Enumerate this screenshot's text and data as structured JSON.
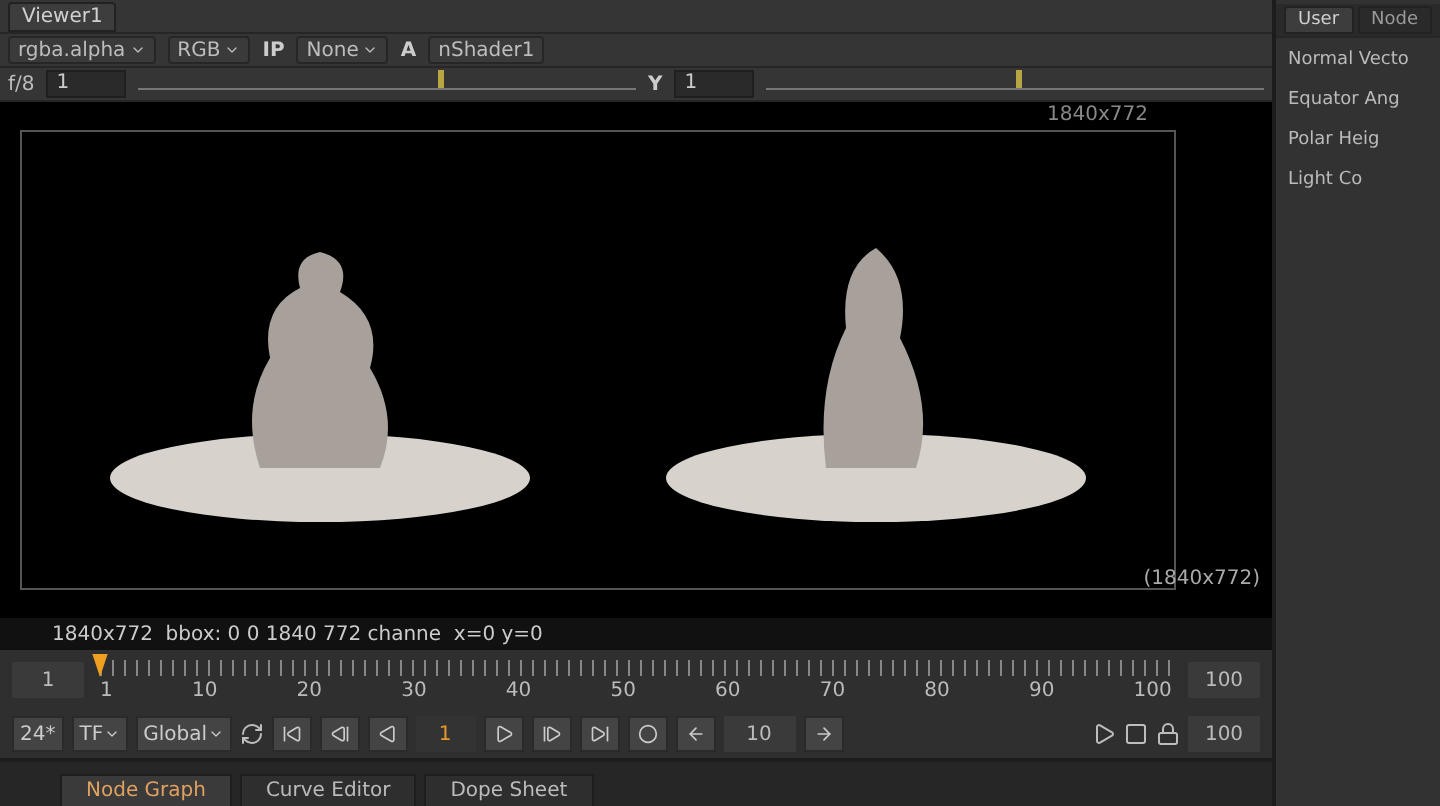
{
  "viewer_tab": {
    "label": "Viewer1"
  },
  "toolbar_a": {
    "channels": "rgba.alpha",
    "display": "RGB",
    "ip": "IP",
    "input_process": "None",
    "input_label": "A",
    "input_node": "nShader1"
  },
  "toolbar_b": {
    "fstop": "f/8",
    "gain": {
      "value": "1",
      "level": 0.6
    },
    "gamma_label": "Y",
    "gamma": {
      "value": "1",
      "level": 0.5
    }
  },
  "viewer": {
    "format_top": "1840x772",
    "format_label": "(1840x772)"
  },
  "info_line": "1840x772  bbox: 0 0 1840 772 channe  x=0 y=0",
  "timeline": {
    "start": "1",
    "end": "100",
    "level": 0.0,
    "labels": [
      "1",
      "10",
      "20",
      "30",
      "40",
      "50",
      "60",
      "70",
      "80",
      "90",
      "100"
    ]
  },
  "controls": {
    "fps": "24*",
    "time_mode": "TF",
    "scope": "Global",
    "frame": "1",
    "increment": "10",
    "end": "100"
  },
  "bottom_tabs": [
    {
      "label": "Node Graph",
      "selected": true
    },
    {
      "label": "Curve Editor",
      "selected": false
    },
    {
      "label": "Dope Sheet",
      "selected": false
    }
  ],
  "properties": {
    "tabs": [
      {
        "label": "User",
        "selected": true
      },
      {
        "label": "Node",
        "selected": false
      }
    ],
    "fields": [
      "Normal Vecto",
      "Equator Ang",
      "Polar Heig",
      "Light Co"
    ]
  }
}
